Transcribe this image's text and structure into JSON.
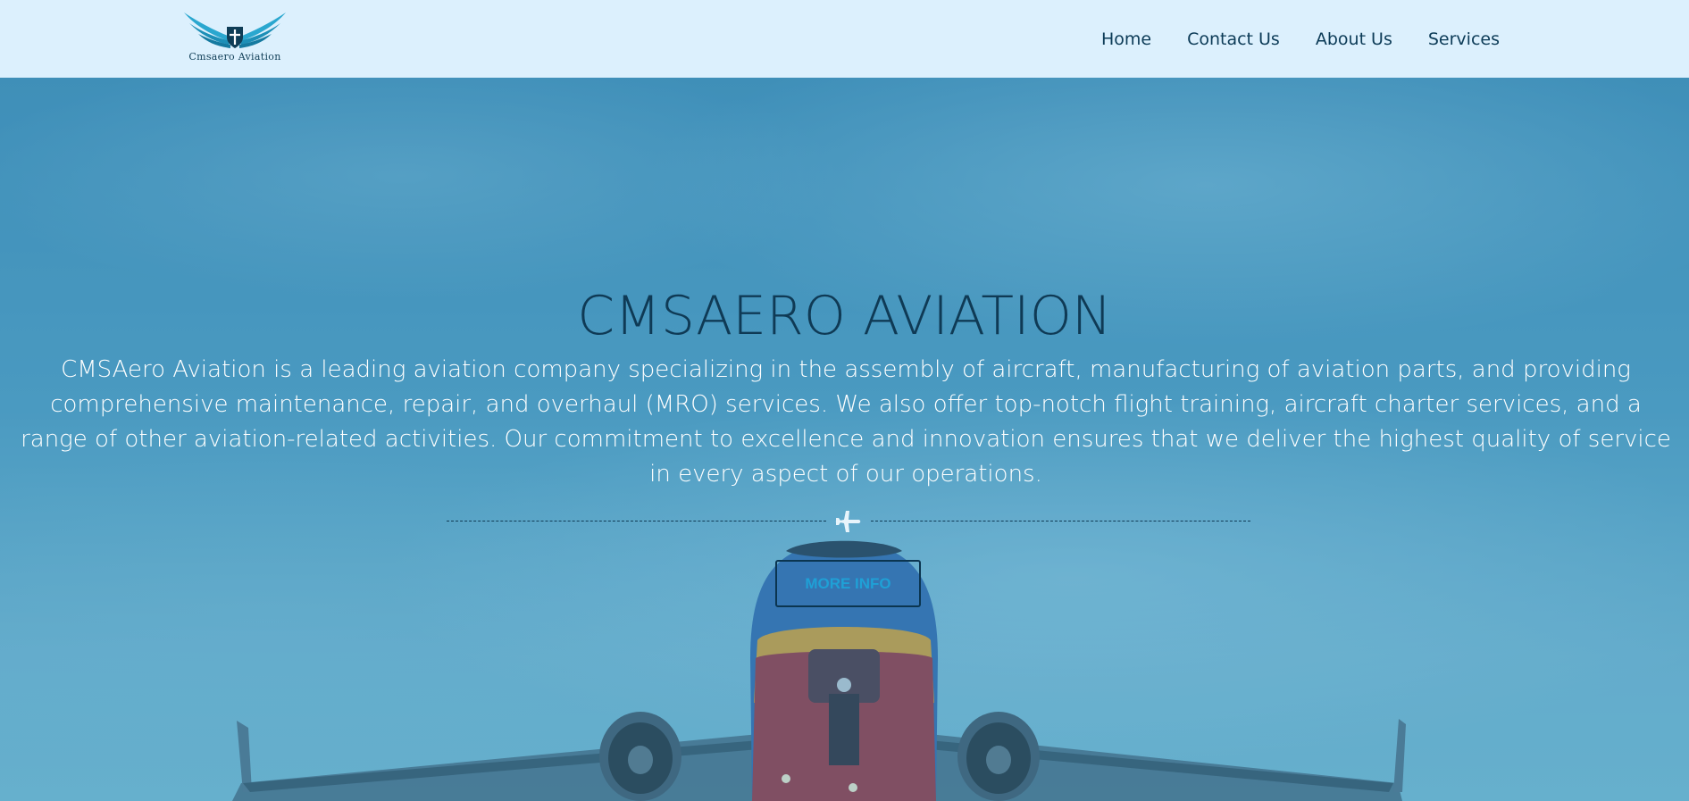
{
  "header": {
    "logo_text": "Cmsaero Aviation",
    "nav": [
      {
        "label": "Home"
      },
      {
        "label": "Contact Us"
      },
      {
        "label": "About Us"
      },
      {
        "label": "Services"
      }
    ]
  },
  "hero": {
    "title": "CMSAERO AVIATION",
    "description": "CMSAero Aviation is a leading aviation company specializing in the assembly of aircraft, manufacturing of aviation parts, and providing comprehensive maintenance, repair, and overhaul (MRO) services. We also offer top-notch flight training, aircraft charter services, and a range of other aviation-related activities. Our commitment to excellence and innovation ensures that we deliver the highest quality of service in every aspect of our operations.",
    "divider_icon": "airplane-icon",
    "button_label": "MORE INFO",
    "background_image": "airplane-taking-off"
  },
  "colors": {
    "header_bg": "#dcf0fd",
    "nav_text": "#0c3b57",
    "title_text": "#0f3a55",
    "button_text": "#1fa0d6",
    "button_border": "#0b3550"
  }
}
